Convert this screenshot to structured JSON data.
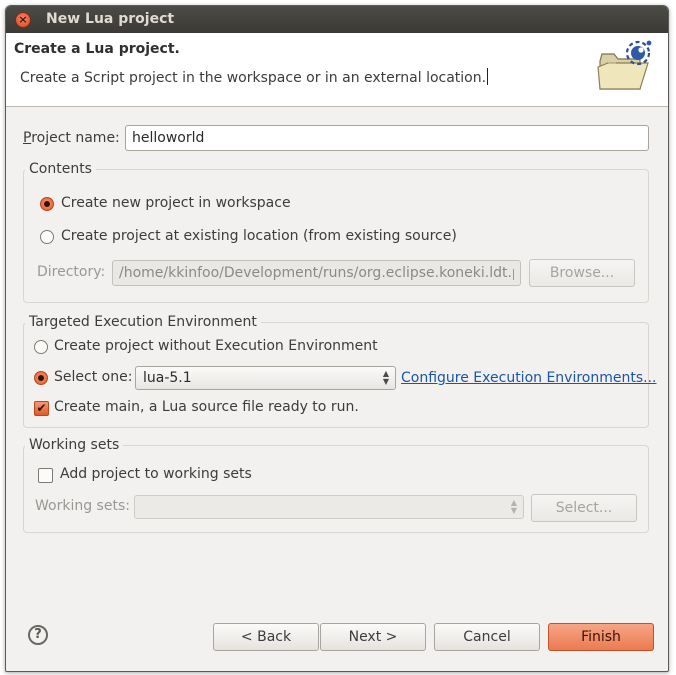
{
  "window": {
    "title": "New Lua project",
    "close_glyph": "×"
  },
  "header": {
    "title": "Create a Lua project.",
    "description": "Create a Script project in the workspace or in an external location."
  },
  "project_name": {
    "label": "Project name:",
    "value": "helloworld"
  },
  "contents": {
    "title": "Contents",
    "options": [
      {
        "label": "Create new project in workspace",
        "checked": true
      },
      {
        "label": "Create project at existing location (from existing source)",
        "checked": false
      }
    ],
    "directory": {
      "label": "Directory:",
      "value": "/home/kkinfoo/Development/runs/org.eclipse.koneki.ldt.pr",
      "browse_label": "Browse..."
    }
  },
  "execution": {
    "title": "Targeted Execution Environment",
    "option_none": "Create project without Execution Environment",
    "option_select": "Select one:",
    "selected_env": "lua-5.1",
    "configure_link": "Configure Execution Environments...",
    "create_main": "Create main, a Lua source file ready to run."
  },
  "working_sets": {
    "title": "Working sets",
    "add_label": "Add project to working sets",
    "sets_label": "Working sets:",
    "select_label": "Select..."
  },
  "buttons": {
    "back": "< Back",
    "next": "Next >",
    "cancel": "Cancel",
    "finish": "Finish"
  },
  "help_glyph": "?",
  "colors": {
    "accent": "#de5a27",
    "link": "#1a55a8",
    "titlebar": "#3c3b37"
  },
  "icons": [
    "close-icon",
    "new-project-folder-icon",
    "help-icon",
    "checkmark-icon",
    "spinner-arrows-icon"
  ]
}
